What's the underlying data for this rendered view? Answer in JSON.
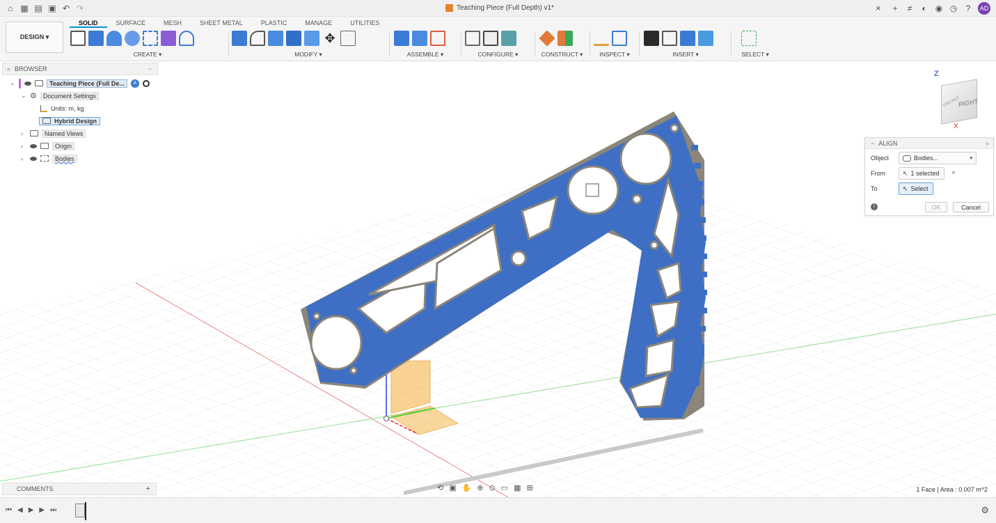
{
  "app": {
    "document_title": "Teaching Piece (Full Depth) v1*",
    "user_initials": "AD"
  },
  "workspace": {
    "design_label": "DESIGN ▾",
    "tabs": [
      "SOLID",
      "SURFACE",
      "MESH",
      "SHEET METAL",
      "PLASTIC",
      "MANAGE",
      "UTILITIES"
    ],
    "active_tab": "SOLID",
    "groups": [
      "CREATE ▾",
      "MODIFY ▾",
      "ASSEMBLE ▾",
      "CONFIGURE ▾",
      "CONSTRUCT ▾",
      "INSPECT ▾",
      "INSERT ▾",
      "SELECT ▾"
    ]
  },
  "browser": {
    "header": "BROWSER",
    "root": "Teaching Piece (Full De...",
    "document_settings": "Document Settings",
    "units": "Units: m, kg",
    "hybrid": "Hybrid Design",
    "named_views": "Named Views",
    "origin": "Origin",
    "bodies": "Bodies"
  },
  "align_dialog": {
    "title": "ALIGN",
    "object_label": "Object",
    "object_value": "Bodies...",
    "from_label": "From",
    "from_value": "1 selected",
    "to_label": "To",
    "to_value": "Select",
    "ok": "OK",
    "cancel": "Cancel"
  },
  "viewcube": {
    "face_right": "RIGHT",
    "face_front": "FRONT",
    "axis_z": "Z",
    "axis_x": "X"
  },
  "comments": {
    "label": "COMMENTS",
    "add": "+"
  },
  "status": {
    "text": "1 Face | Area : 0.007 m^2"
  },
  "colors": {
    "body_blue": "#3e6fc4",
    "body_edge": "#7f7a70",
    "accent": "#0696d7",
    "origin_plane": "#f5a623"
  }
}
